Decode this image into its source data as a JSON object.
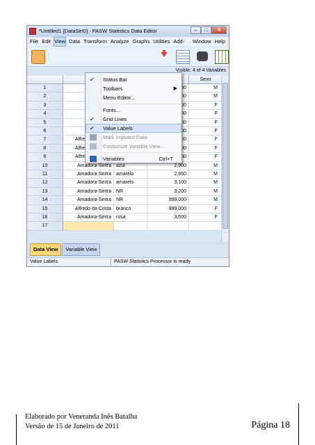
{
  "window": {
    "title": "*Untitled1 [DataSet0] - PASW Statistics Data Editor",
    "buttons": {
      "minimize": "–",
      "maximize": "□",
      "close": "✕"
    }
  },
  "menubar": [
    "File",
    "Edit",
    "View",
    "Data",
    "Transform",
    "Analyze",
    "Graphs",
    "Utilities",
    "Add-ons",
    "Window",
    "Help"
  ],
  "view_menu": {
    "items": [
      {
        "label": "Status Bar",
        "checked": true
      },
      {
        "label": "Toolbars",
        "submenu": true
      },
      {
        "label": "Menu Editor..."
      },
      {
        "label": "Fonts..."
      },
      {
        "label": "Grid Lines",
        "checked": true
      },
      {
        "label": "Value Labels",
        "checked": true,
        "highlighted": true
      },
      {
        "label": "Mark Imputed Data",
        "disabled": true
      },
      {
        "label": "Customize Variable View...",
        "disabled": true
      },
      {
        "label": "Variables",
        "shortcut": "Ctrl+T"
      }
    ]
  },
  "visible_label": "Visible: 4 of 4 Variables",
  "grid": {
    "headers": [
      "",
      "",
      "Peso",
      "Sexo"
    ],
    "rows": [
      {
        "n": "1",
        "local": "",
        "cor": "",
        "peso": "1,950",
        "sexo": "M"
      },
      {
        "n": "2",
        "local": "",
        "cor": "",
        "peso": "3,300",
        "sexo": "M"
      },
      {
        "n": "3",
        "local": "",
        "cor": "",
        "peso": "2,800",
        "sexo": "F"
      },
      {
        "n": "4",
        "local": "",
        "cor": "",
        "peso": "2,500",
        "sexo": "F"
      },
      {
        "n": "5",
        "local": "",
        "cor": "",
        "peso": "2,750",
        "sexo": "F"
      },
      {
        "n": "6",
        "local": "",
        "cor": "",
        "peso": "2,200",
        "sexo": "F"
      },
      {
        "n": "7",
        "local": "Alfredo da Costa",
        "cor": "amarelo",
        "peso": "3,900",
        "sexo": "F"
      },
      {
        "n": "8",
        "local": "Alfredo da Costa",
        "cor": "branco",
        "peso": "4,100",
        "sexo": "F"
      },
      {
        "n": "9",
        "local": "Alfredo da Costa",
        "cor": "rosa",
        "peso": "3,100",
        "sexo": "F"
      },
      {
        "n": "10",
        "local": "Amadora-Sintra",
        "cor": "azul",
        "peso": "2,900",
        "sexo": "M"
      },
      {
        "n": "11",
        "local": "Amadora-Sintra",
        "cor": "amarelo",
        "peso": "2,950",
        "sexo": "M"
      },
      {
        "n": "12",
        "local": "Amadora-Sintra",
        "cor": "amarelo",
        "peso": "3,100",
        "sexo": "M"
      },
      {
        "n": "13",
        "local": "Amadora-Sintra",
        "cor": "NR",
        "peso": "3,200",
        "sexo": "M"
      },
      {
        "n": "14",
        "local": "Amadora-Sintra",
        "cor": "NR",
        "peso": "999,000",
        "sexo": "M"
      },
      {
        "n": "15",
        "local": "Alfredo da Costa",
        "cor": "branco",
        "peso": "999,000",
        "sexo": "F"
      },
      {
        "n": "16",
        "local": "Amadora-Sintra",
        "cor": "rosa",
        "peso": "3,500",
        "sexo": "F"
      },
      {
        "n": "17",
        "local": "",
        "cor": "",
        "peso": "",
        "sexo": ""
      }
    ]
  },
  "tabs": [
    {
      "label": "Data View",
      "active": true
    },
    {
      "label": "Variable View",
      "active": false
    }
  ],
  "status": {
    "left": "Value Labels",
    "right": "PASW Statistics Processor is ready"
  },
  "footer": {
    "line1": "Elaborado por Veneranda Inês Batalha",
    "line2": "Versão de 15 de Janeiro de 2011",
    "page": "Página 18"
  }
}
